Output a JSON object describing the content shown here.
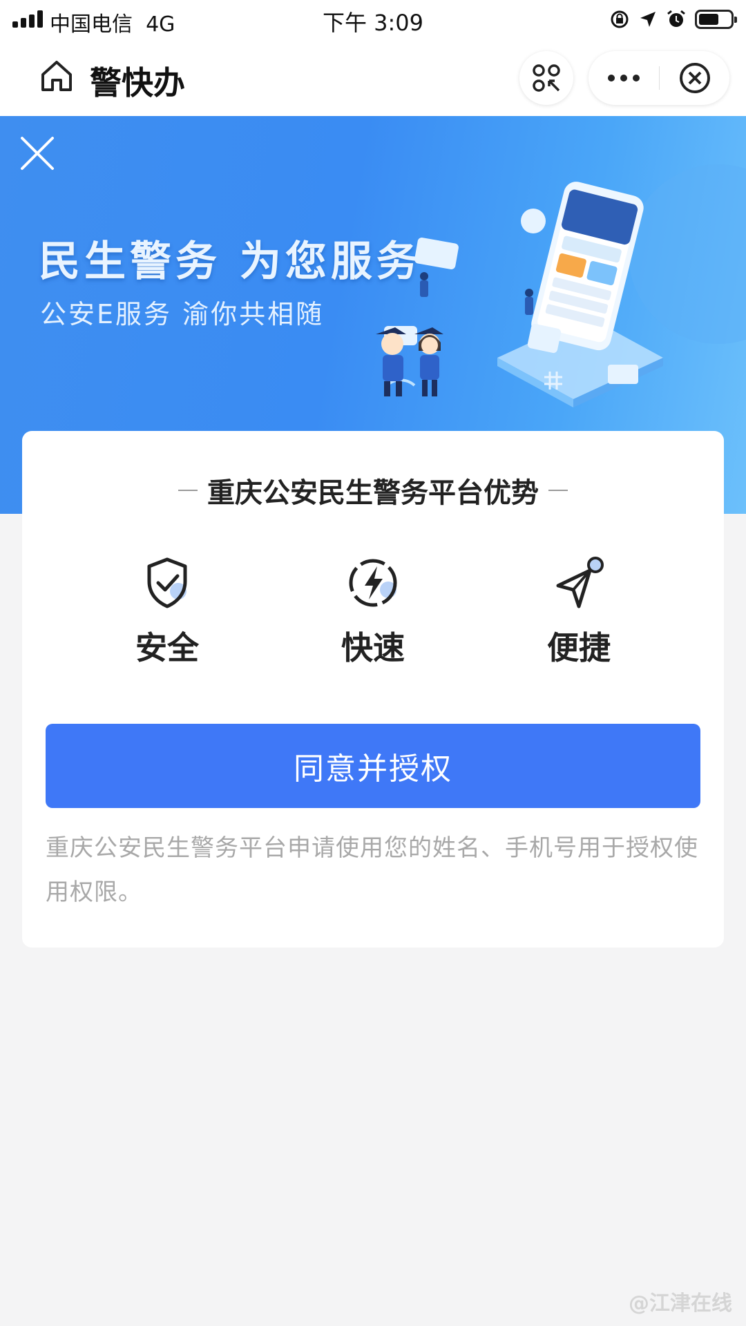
{
  "status_bar": {
    "carrier": "中国电信",
    "network": "4G",
    "time": "下午 3:09",
    "icons": [
      "signal-icon",
      "orientation-lock-icon",
      "location-icon",
      "alarm-icon",
      "battery-icon"
    ]
  },
  "nav": {
    "title": "警快办",
    "icons": [
      "home-icon",
      "scan-icon",
      "more-icon",
      "close-circle-icon"
    ]
  },
  "banner": {
    "title": "民生警务 为您服务",
    "subtitle": "公安E服务 渝你共相随"
  },
  "card": {
    "heading": "重庆公安民生警务平台优势",
    "features": [
      {
        "label": "安全",
        "icon": "shield-check-icon"
      },
      {
        "label": "快速",
        "icon": "lightning-icon"
      },
      {
        "label": "便捷",
        "icon": "paper-plane-icon"
      }
    ],
    "agree_button": "同意并授权",
    "disclaimer": "重庆公安民生警务平台申请使用您的姓名、手机号用于授权使用权限。"
  },
  "watermark": "@江津在线",
  "colors": {
    "banner_blue": "#3f8ef0",
    "button_blue": "#3f78f7",
    "accent_light_blue": "#8db8f7",
    "page_bg": "#f4f4f5"
  }
}
